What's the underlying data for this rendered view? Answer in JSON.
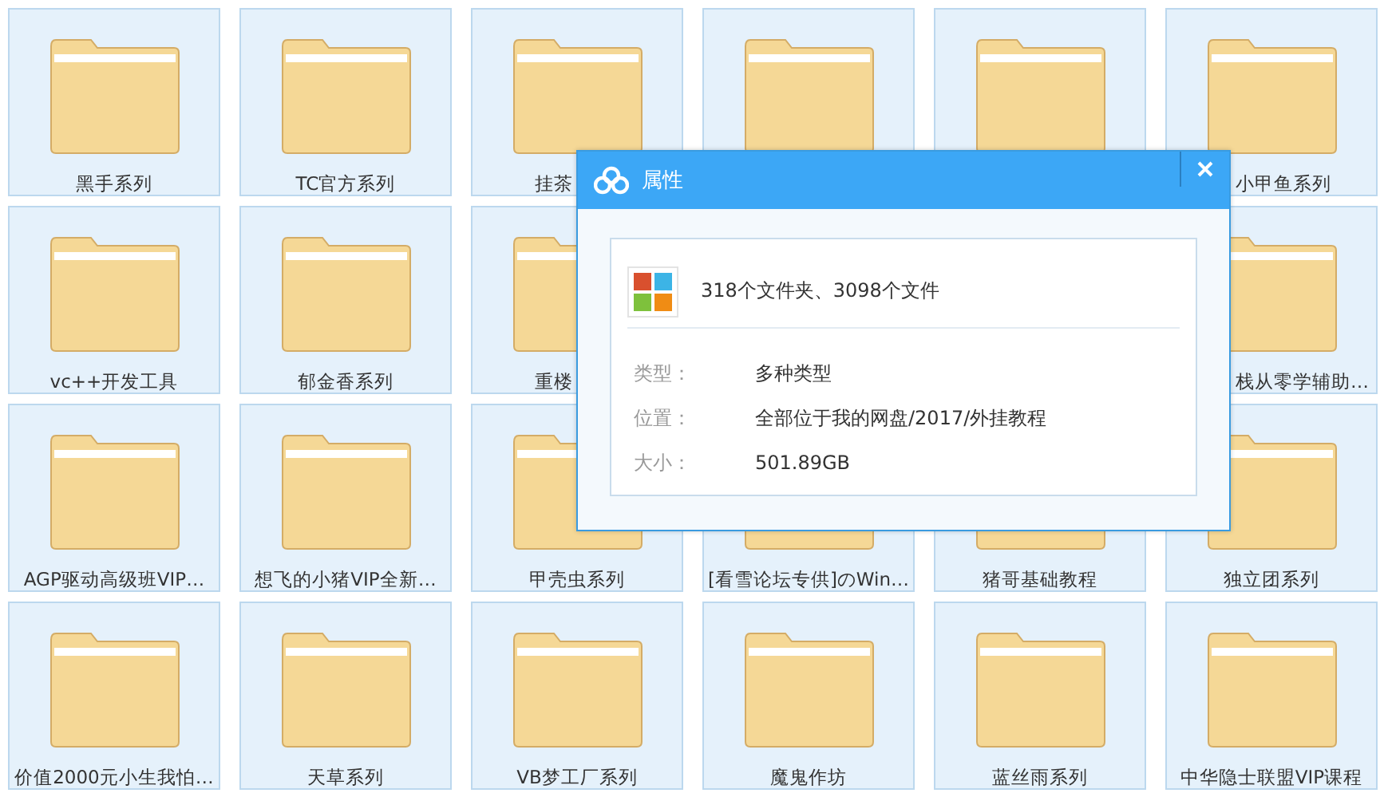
{
  "folders": [
    {
      "kind": "folder",
      "label": "黑手系列"
    },
    {
      "kind": "folder",
      "label": "TC官方系列"
    },
    {
      "kind": "folder",
      "label": "挂茶"
    },
    {
      "kind": "folder"
    },
    {
      "kind": "folder"
    },
    {
      "kind": "folder",
      "label": "小甲鱼系列"
    },
    {
      "kind": "folder",
      "label": "vc++开发工具"
    },
    {
      "kind": "folder",
      "label": "郁金香系列"
    },
    {
      "kind": "folder",
      "label": "重楼"
    },
    {
      "kind": "covered"
    },
    {
      "kind": "covered"
    },
    {
      "kind": "folder",
      "label": "栈从零学辅助…"
    },
    {
      "kind": "folder",
      "label": "AGP驱动高级班VIP…"
    },
    {
      "kind": "folder",
      "label": "想飞的小猪VIP全新…"
    },
    {
      "kind": "folder",
      "label": "甲壳虫系列"
    },
    {
      "kind": "folder",
      "label": "[看雪论坛专供]のWin…"
    },
    {
      "kind": "folder",
      "label": "猪哥基础教程"
    },
    {
      "kind": "folder",
      "label": "独立团系列"
    },
    {
      "kind": "folder",
      "label": "价值2000元小生我怕…"
    },
    {
      "kind": "folder",
      "label": "天草系列"
    },
    {
      "kind": "folder",
      "label": "VB梦工厂系列"
    },
    {
      "kind": "folder",
      "label": "魔鬼作坊"
    },
    {
      "kind": "folder",
      "label": "蓝丝雨系列"
    },
    {
      "kind": "folder",
      "label": "中华隐士联盟VIP课程"
    }
  ],
  "dialog": {
    "title": "属性",
    "summary": "318个文件夹、3098个文件",
    "properties": [
      {
        "label": "类型：",
        "value": "多种类型"
      },
      {
        "label": "位置：",
        "value": "全部位于我的网盘/2017/外挂教程"
      },
      {
        "label": "大小：",
        "value": "501.89GB"
      }
    ]
  }
}
